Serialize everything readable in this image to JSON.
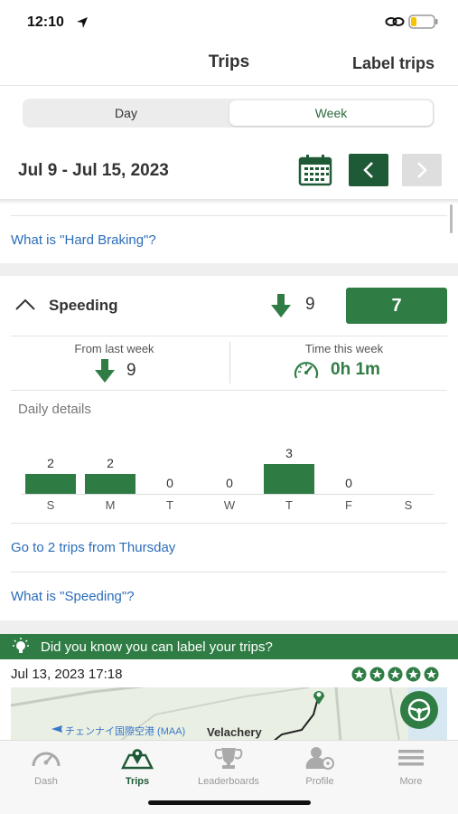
{
  "status": {
    "time": "12:10"
  },
  "header": {
    "title": "Trips",
    "label_trips": "Label trips"
  },
  "segment": {
    "day": "Day",
    "week": "Week",
    "selected": "Week"
  },
  "date_nav": {
    "range": "Jul 9 - Jul 15, 2023"
  },
  "hard_braking": {
    "link": "What is \"Hard Braking\"?"
  },
  "speeding": {
    "title": "Speeding",
    "change_value": "9",
    "score": "7",
    "from_last_week_label": "From last week",
    "from_last_week_value": "9",
    "time_label": "Time this week",
    "time_value": "0h  1m",
    "daily_title": "Daily details",
    "days": [
      {
        "day": "S",
        "count": "2",
        "value": 2
      },
      {
        "day": "M",
        "count": "2",
        "value": 2
      },
      {
        "day": "T",
        "count": "0",
        "value": 0
      },
      {
        "day": "W",
        "count": "0",
        "value": 0
      },
      {
        "day": "T",
        "count": "3",
        "value": 3
      },
      {
        "day": "F",
        "count": "0",
        "value": 0
      },
      {
        "day": "S",
        "count": "",
        "value": 0
      }
    ],
    "goto_link": "Go to 2 trips from Thursday",
    "what_link": "What is \"Speeding\"?"
  },
  "tip": {
    "text": "Did you know you can label your trips?"
  },
  "trip": {
    "date": "Jul 13, 2023 17:18",
    "stars": 5,
    "map_place": "Velachery",
    "map_airport": "チェンナイ国際空港 (MAA)"
  },
  "tabs": [
    {
      "label": "Dash",
      "icon": "gauge-icon"
    },
    {
      "label": "Trips",
      "icon": "map-pin-icon"
    },
    {
      "label": "Leaderboards",
      "icon": "trophy-icon"
    },
    {
      "label": "Profile",
      "icon": "profile-icon"
    },
    {
      "label": "More",
      "icon": "menu-icon"
    }
  ],
  "colors": {
    "accent": "#2f7d45",
    "dark_accent": "#1f5a36",
    "link": "#2a6db8"
  }
}
